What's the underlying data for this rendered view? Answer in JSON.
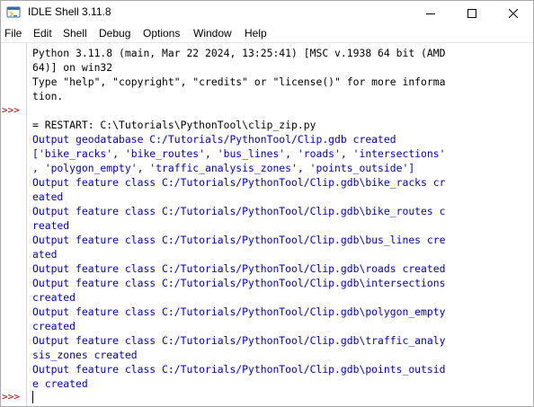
{
  "window": {
    "title": "IDLE Shell 3.11.8",
    "controls": {
      "minimize": "minimize",
      "maximize": "maximize",
      "close": "close"
    }
  },
  "menu": {
    "items": [
      "File",
      "Edit",
      "Shell",
      "Debug",
      "Options",
      "Window",
      "Help"
    ]
  },
  "shell": {
    "prompt": ">>>",
    "lines": [
      {
        "text": "Python 3.11.8 (main, Mar 22 2024, 13:25:41) [MSC v.1938 64 bit (AMD",
        "color": "black"
      },
      {
        "text": "64)] on win32",
        "color": "black"
      },
      {
        "text": "Type \"help\", \"copyright\", \"credits\" or \"license()\" for more informa",
        "color": "black"
      },
      {
        "text": "tion.",
        "color": "black"
      },
      {
        "text": "",
        "color": "black"
      },
      {
        "text": "= RESTART: C:\\Tutorials\\PythonTool\\clip_zip.py",
        "color": "black"
      },
      {
        "text": "Output geodatabase C:/Tutorials/PythonTool/Clip.gdb created",
        "color": "blue"
      },
      {
        "text": "['bike_racks', 'bike_routes', 'bus_lines', 'roads', 'intersections'",
        "color": "blue"
      },
      {
        "text": ", 'polygon_empty', 'traffic_analysis_zones', 'points_outside']",
        "color": "blue"
      },
      {
        "text": "Output feature class C:/Tutorials/PythonTool/Clip.gdb\\bike_racks cr",
        "color": "blue"
      },
      {
        "text": "eated",
        "color": "blue"
      },
      {
        "text": "Output feature class C:/Tutorials/PythonTool/Clip.gdb\\bike_routes c",
        "color": "blue"
      },
      {
        "text": "reated",
        "color": "blue"
      },
      {
        "text": "Output feature class C:/Tutorials/PythonTool/Clip.gdb\\bus_lines cre",
        "color": "blue"
      },
      {
        "text": "ated",
        "color": "blue"
      },
      {
        "text": "Output feature class C:/Tutorials/PythonTool/Clip.gdb\\roads created",
        "color": "blue"
      },
      {
        "text": "Output feature class C:/Tutorials/PythonTool/Clip.gdb\\intersections",
        "color": "blue"
      },
      {
        "text": "created",
        "color": "blue"
      },
      {
        "text": "Output feature class C:/Tutorials/PythonTool/Clip.gdb\\polygon_empty",
        "color": "blue"
      },
      {
        "text": "created",
        "color": "blue"
      },
      {
        "text": "Output feature class C:/Tutorials/PythonTool/Clip.gdb\\traffic_analy",
        "color": "blue"
      },
      {
        "text": "sis_zones created",
        "color": "blue"
      },
      {
        "text": "Output feature class C:/Tutorials/PythonTool/Clip.gdb\\points_outsid",
        "color": "blue"
      },
      {
        "text": "e created",
        "color": "blue"
      },
      {
        "text": "",
        "color": "black"
      }
    ],
    "colors": {
      "prompt": "#c00000",
      "output": "#0000c0",
      "text": "#000000"
    }
  }
}
